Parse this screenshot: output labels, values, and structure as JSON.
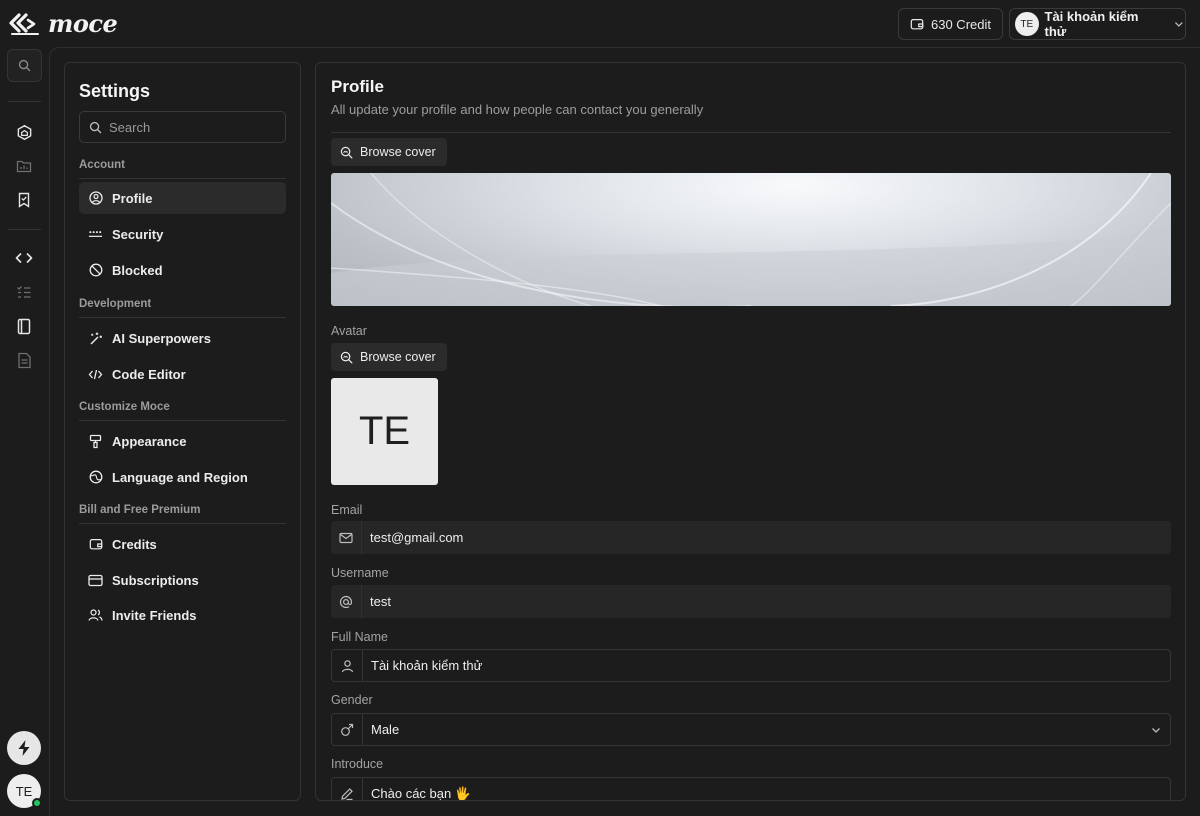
{
  "brand": {
    "name": "moce"
  },
  "topbar": {
    "credit_label": "630 Credit",
    "account_initials": "TE",
    "account_name": "Tài khoản kiểm thử"
  },
  "rail": {
    "user_initials": "TE"
  },
  "settings": {
    "title": "Settings",
    "search_placeholder": "Search",
    "groups": [
      {
        "label": "Account",
        "items": [
          "Profile",
          "Security",
          "Blocked"
        ]
      },
      {
        "label": "Development",
        "items": [
          "AI Superpowers",
          "Code Editor"
        ]
      },
      {
        "label": "Customize Moce",
        "items": [
          "Appearance",
          "Language and Region"
        ]
      },
      {
        "label": "Bill and Free Premium",
        "items": [
          "Credits",
          "Subscriptions",
          "Invite Friends"
        ]
      }
    ],
    "active_item": "Profile"
  },
  "profile": {
    "title": "Profile",
    "subtitle": "All update your profile and how people can contact you generally",
    "cover_button": "Browse cover",
    "avatar_label": "Avatar",
    "avatar_button": "Browse cover",
    "avatar_initials": "TE",
    "fields": {
      "email": {
        "label": "Email",
        "value": "test@gmail.com"
      },
      "username": {
        "label": "Username",
        "value": "test"
      },
      "full_name": {
        "label": "Full Name",
        "value": "Tài khoản kiểm thử"
      },
      "gender": {
        "label": "Gender",
        "value": "Male"
      },
      "introduce": {
        "label": "Introduce",
        "value": "Chào các bạn 🖐"
      }
    }
  },
  "colors": {
    "background": "#1c1c1c",
    "panel_border": "#333333",
    "active_item": "#2b2b2b",
    "online": "#22c55e"
  }
}
